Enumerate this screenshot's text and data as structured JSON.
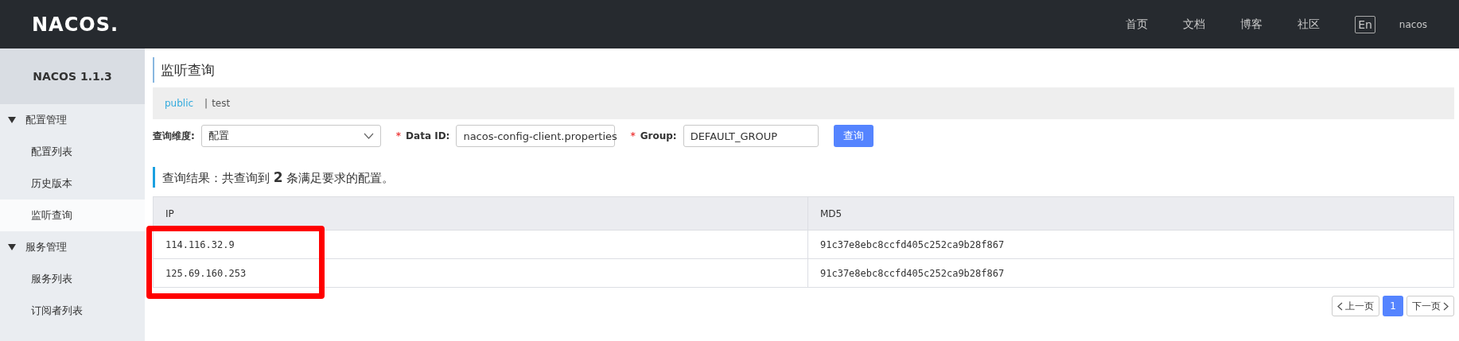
{
  "header": {
    "logo": "NACOS.",
    "nav": [
      {
        "label": "首页"
      },
      {
        "label": "文档"
      },
      {
        "label": "博客"
      },
      {
        "label": "社区"
      }
    ],
    "language": "En",
    "user": "nacos"
  },
  "sidebar": {
    "title": "NACOS 1.1.3",
    "items": [
      {
        "kind": "section",
        "label": "配置管理",
        "expanded": true,
        "selected": false
      },
      {
        "kind": "link",
        "label": "配置列表",
        "selected": false
      },
      {
        "kind": "link",
        "label": "历史版本",
        "selected": false
      },
      {
        "kind": "link",
        "label": "监听查询",
        "selected": true
      },
      {
        "kind": "section",
        "label": "服务管理",
        "expanded": true,
        "selected": false
      },
      {
        "kind": "link",
        "label": "服务列表",
        "selected": false
      },
      {
        "kind": "link",
        "label": "订阅者列表",
        "selected": false
      }
    ]
  },
  "page_title": "监听查询",
  "namespace_bar": {
    "separator": "|",
    "tabs": [
      {
        "label": "public",
        "selected": true
      },
      {
        "label": "test",
        "selected": false
      }
    ]
  },
  "filters": {
    "dimension": {
      "label": "查询维度:",
      "value": "配置"
    },
    "data_id": {
      "label": "Data ID:",
      "required_mark": "*",
      "value": "nacos-config-client.properties"
    },
    "group": {
      "label": "Group:",
      "required_mark": "*",
      "value": "DEFAULT_GROUP"
    },
    "search_button": "查询"
  },
  "result_summary": "查询结果：共查询到 **2** 条满足要求的配置。",
  "table": {
    "columns": [
      "IP",
      "MD5"
    ],
    "rows": [
      [
        "114.116.32.9",
        "91c37e8ebc8ccfd405c252ca9b28f867"
      ],
      [
        "125.69.160.253",
        "91c37e8ebc8ccfd405c252ca9b28f867"
      ]
    ]
  },
  "pagination": {
    "prev": "上一页",
    "pages": [
      {
        "label": "1",
        "selected": true
      }
    ],
    "next": "下一页"
  }
}
